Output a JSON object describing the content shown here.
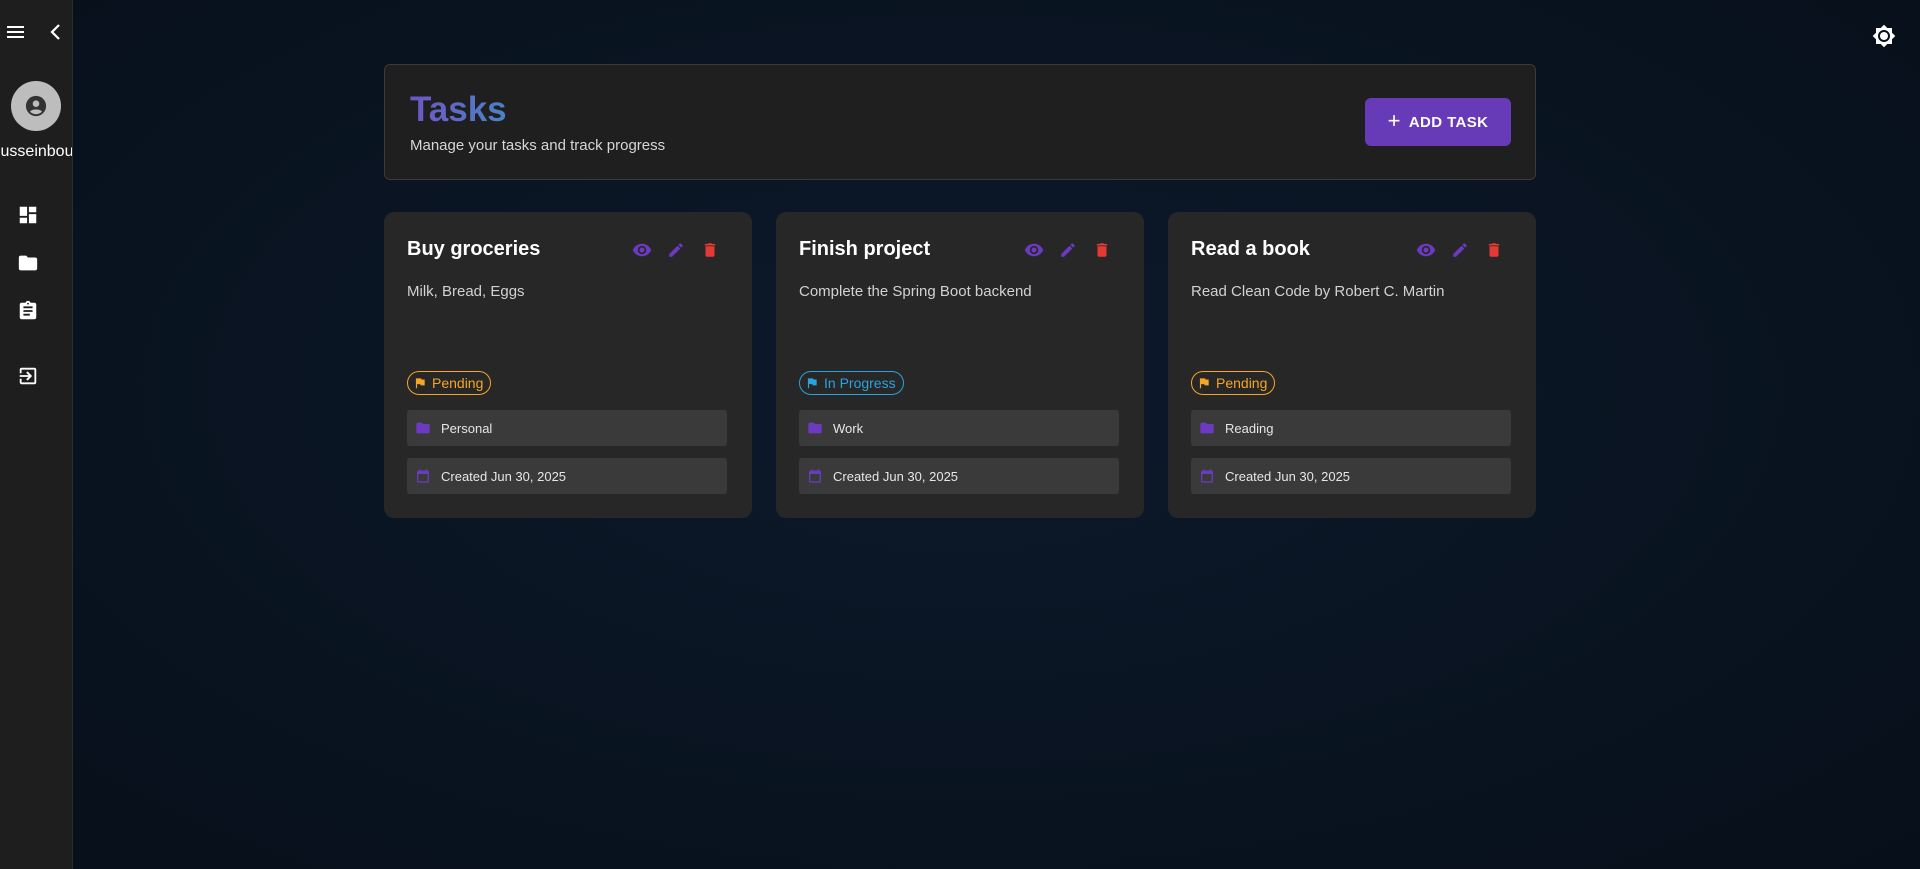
{
  "sidebar": {
    "username": "usseinbou"
  },
  "header": {
    "title": "Tasks",
    "subtitle": "Manage your tasks and track progress",
    "add_button_label": "ADD TASK"
  },
  "tasks": [
    {
      "title": "Buy groceries",
      "description": "Milk, Bread, Eggs",
      "status": "Pending",
      "category": "Personal",
      "created": "Created Jun 30, 2025"
    },
    {
      "title": "Finish project",
      "description": "Complete the Spring Boot backend",
      "status": "In Progress",
      "category": "Work",
      "created": "Created Jun 30, 2025"
    },
    {
      "title": "Read a book",
      "description": "Read Clean Code by Robert C. Martin",
      "status": "Pending",
      "category": "Reading",
      "created": "Created Jun 30, 2025"
    }
  ],
  "colors": {
    "accent": "#673ab7",
    "icon_purple": "#6a3bc0",
    "delete_red": "#e53935",
    "pending": "#f5a623",
    "in_progress": "#29a3e0"
  },
  "icons": [
    "menu-icon",
    "chevron-left-icon",
    "account-circle-icon",
    "dashboard-icon",
    "folder-icon",
    "assignment-icon",
    "logout-icon",
    "theme-toggle-icon",
    "eye-icon",
    "edit-icon",
    "delete-icon",
    "flag-icon",
    "calendar-icon",
    "plus-icon"
  ]
}
